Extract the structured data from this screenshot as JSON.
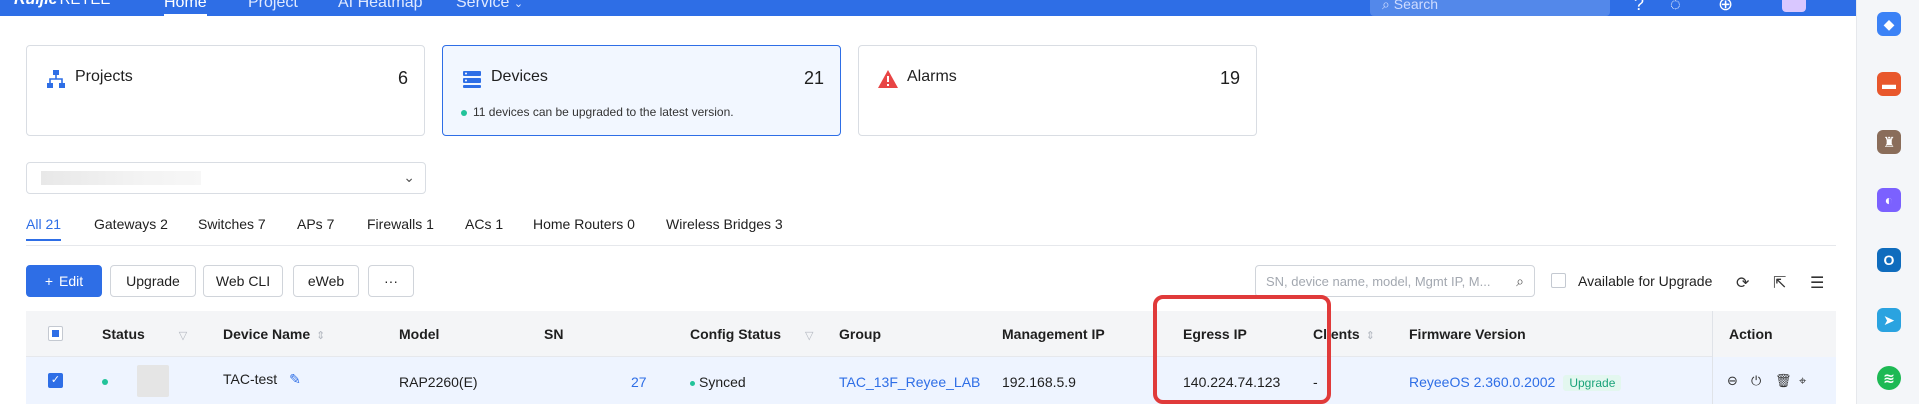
{
  "topnav": {
    "brand": "Ruijie",
    "brand_sub": "REYEE",
    "items": [
      {
        "label": "Home",
        "active": true
      },
      {
        "label": "Project"
      },
      {
        "label": "AI Heatmap"
      },
      {
        "label": "Service"
      }
    ],
    "search_placeholder": "Search"
  },
  "cards": [
    {
      "title": "Projects",
      "count": "6"
    },
    {
      "title": "Devices",
      "count": "21",
      "note": "11 devices can be upgraded to the latest version."
    },
    {
      "title": "Alarms",
      "count": "19"
    }
  ],
  "tabs": [
    "All 21",
    "Gateways 2",
    "Switches 7",
    "APs 7",
    "Firewalls 1",
    "ACs 1",
    "Home Routers 0",
    "Wireless Bridges 3"
  ],
  "toolbar": {
    "edit": "Edit",
    "upgrade": "Upgrade",
    "webcli": "Web CLI",
    "eweb": "eWeb",
    "more": "···",
    "search_placeholder": "SN, device name, model, Mgmt IP, M...",
    "available_label": "Available for Upgrade"
  },
  "table": {
    "columns": {
      "status": "Status",
      "device_name": "Device Name",
      "model": "Model",
      "sn": "SN",
      "config_status": "Config Status",
      "group": "Group",
      "mgmt_ip": "Management IP",
      "egress_ip": "Egress IP",
      "clients": "Clients",
      "firmware": "Firmware Version",
      "action": "Action"
    },
    "rows": [
      {
        "device_name": "TAC-test",
        "model": "RAP2260(E)",
        "sn": "27",
        "config_status": "Synced",
        "group": "TAC_13F_Reyee_LAB",
        "mgmt_ip": "192.168.5.9",
        "egress_ip": "140.224.74.123",
        "clients": "-",
        "firmware": "ReyeeOS 2.360.0.2002",
        "firmware_badge": "Upgrade"
      }
    ]
  },
  "colors": {
    "primary": "#2e6ee6",
    "highlight": "#e03a3a",
    "success": "#22c39a"
  }
}
